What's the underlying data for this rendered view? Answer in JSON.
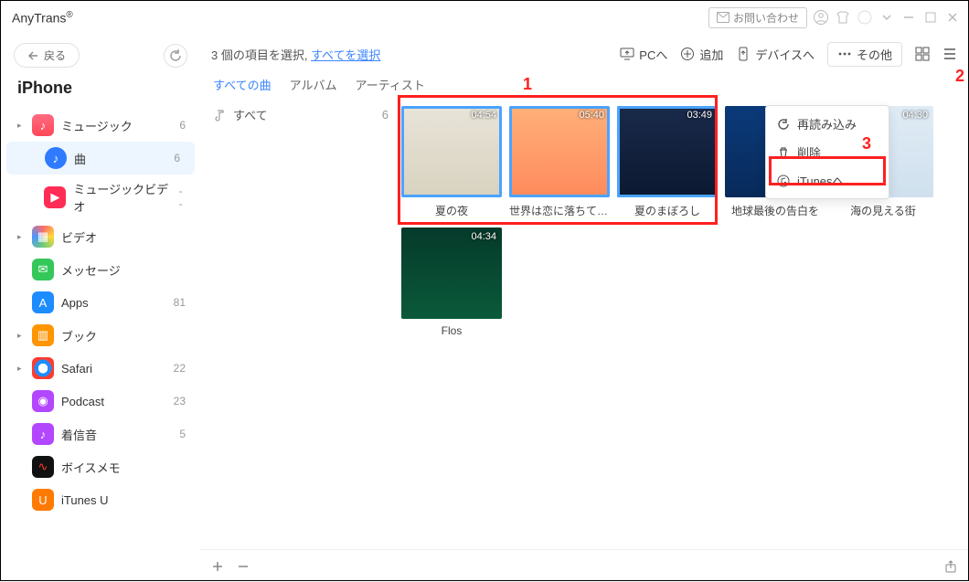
{
  "app": {
    "name": "AnyTrans",
    "reg": "®"
  },
  "titlebar": {
    "contact": "お問い合わせ"
  },
  "sidebar": {
    "back": "戻る",
    "device": "iPhone",
    "items": [
      {
        "label": "ミュージック",
        "count": "6",
        "expandable": true
      },
      {
        "label": "曲",
        "count": "6",
        "child": true,
        "active": true
      },
      {
        "label": "ミュージックビデオ",
        "count": "--",
        "child": true
      },
      {
        "label": "ビデオ",
        "count": "",
        "expandable": true
      },
      {
        "label": "メッセージ",
        "count": ""
      },
      {
        "label": "Apps",
        "count": "81"
      },
      {
        "label": "ブック",
        "count": "",
        "expandable": true
      },
      {
        "label": "Safari",
        "count": "22",
        "expandable": true
      },
      {
        "label": "Podcast",
        "count": "23"
      },
      {
        "label": "着信音",
        "count": "5"
      },
      {
        "label": "ボイスメモ",
        "count": ""
      },
      {
        "label": "iTunes U",
        "count": ""
      }
    ]
  },
  "toolbar": {
    "selection_prefix": "3 個の項目を選択, ",
    "select_all": "すべてを選択",
    "to_pc": "PCへ",
    "add": "追加",
    "to_device": "デバイスへ",
    "more": "その他"
  },
  "tabs": {
    "all_songs": "すべての曲",
    "album": "アルバム",
    "artist": "アーティスト"
  },
  "filter": {
    "all": "すべて",
    "count": "6"
  },
  "dropdown": {
    "reload": "再読み込み",
    "delete": "削除",
    "to_itunes": "iTunesへ"
  },
  "callouts": {
    "one": "1",
    "two": "2",
    "three": "3"
  },
  "tiles": [
    {
      "title": "夏の夜",
      "duration": "04:54",
      "selected": true,
      "cls": "th0"
    },
    {
      "title": "世界は恋に落ちてい...",
      "duration": "05:40",
      "selected": true,
      "cls": "th1"
    },
    {
      "title": "夏のまぼろし",
      "duration": "03:49",
      "selected": true,
      "cls": "th2"
    },
    {
      "title": "地球最後の告白を",
      "duration": "",
      "selected": false,
      "cls": "th3"
    },
    {
      "title": "海の見える街",
      "duration": "04:30",
      "selected": false,
      "cls": "th4"
    },
    {
      "title": "Flos",
      "duration": "04:34",
      "selected": false,
      "cls": "th5"
    }
  ]
}
